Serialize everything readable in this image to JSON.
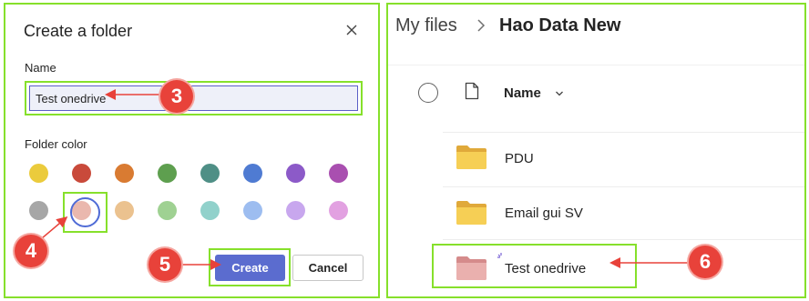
{
  "dialog": {
    "title": "Create a folder",
    "name_label": "Name",
    "name_value": "Test onedrive",
    "color_label": "Folder color",
    "colors_row1": [
      "#ebcb3c",
      "#c94a3b",
      "#d97b32",
      "#5e9f4f",
      "#4f8f86",
      "#4f7bd2",
      "#8c5ac8",
      "#a94fb0"
    ],
    "colors_row2": [
      "#a6a6a6",
      "#eab8ae",
      "#ebc28f",
      "#9fd192",
      "#91d1cb",
      "#9dbdf0",
      "#c8a7ee",
      "#e2a1e1"
    ],
    "selected_color_index": 1,
    "create_label": "Create",
    "cancel_label": "Cancel"
  },
  "files": {
    "breadcrumb_root": "My files",
    "breadcrumb_current": "Hao Data New",
    "column_name": "Name",
    "rows": [
      {
        "name": "PDU",
        "color": "#f2c94c"
      },
      {
        "name": "Email gui SV",
        "color": "#f2c94c"
      },
      {
        "name": "Test onedrive",
        "color": "#e8a6a6"
      }
    ]
  },
  "markers": [
    "3",
    "4",
    "5",
    "6"
  ],
  "accent": "#86e02b",
  "marker_color": "#e8423a"
}
